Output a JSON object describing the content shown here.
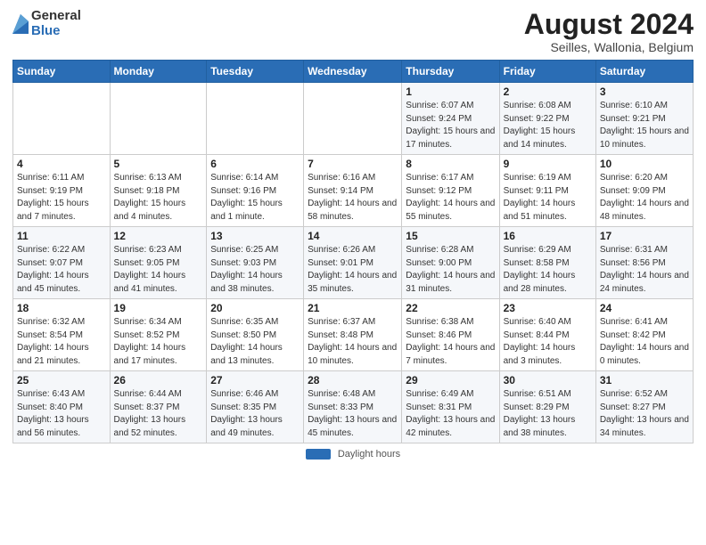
{
  "logo": {
    "general": "General",
    "blue": "Blue"
  },
  "title": "August 2024",
  "subtitle": "Seilles, Wallonia, Belgium",
  "days_of_week": [
    "Sunday",
    "Monday",
    "Tuesday",
    "Wednesday",
    "Thursday",
    "Friday",
    "Saturday"
  ],
  "weeks": [
    [
      {
        "day": "",
        "info": ""
      },
      {
        "day": "",
        "info": ""
      },
      {
        "day": "",
        "info": ""
      },
      {
        "day": "",
        "info": ""
      },
      {
        "day": "1",
        "info": "Sunrise: 6:07 AM\nSunset: 9:24 PM\nDaylight: 15 hours and 17 minutes."
      },
      {
        "day": "2",
        "info": "Sunrise: 6:08 AM\nSunset: 9:22 PM\nDaylight: 15 hours and 14 minutes."
      },
      {
        "day": "3",
        "info": "Sunrise: 6:10 AM\nSunset: 9:21 PM\nDaylight: 15 hours and 10 minutes."
      }
    ],
    [
      {
        "day": "4",
        "info": "Sunrise: 6:11 AM\nSunset: 9:19 PM\nDaylight: 15 hours and 7 minutes."
      },
      {
        "day": "5",
        "info": "Sunrise: 6:13 AM\nSunset: 9:18 PM\nDaylight: 15 hours and 4 minutes."
      },
      {
        "day": "6",
        "info": "Sunrise: 6:14 AM\nSunset: 9:16 PM\nDaylight: 15 hours and 1 minute."
      },
      {
        "day": "7",
        "info": "Sunrise: 6:16 AM\nSunset: 9:14 PM\nDaylight: 14 hours and 58 minutes."
      },
      {
        "day": "8",
        "info": "Sunrise: 6:17 AM\nSunset: 9:12 PM\nDaylight: 14 hours and 55 minutes."
      },
      {
        "day": "9",
        "info": "Sunrise: 6:19 AM\nSunset: 9:11 PM\nDaylight: 14 hours and 51 minutes."
      },
      {
        "day": "10",
        "info": "Sunrise: 6:20 AM\nSunset: 9:09 PM\nDaylight: 14 hours and 48 minutes."
      }
    ],
    [
      {
        "day": "11",
        "info": "Sunrise: 6:22 AM\nSunset: 9:07 PM\nDaylight: 14 hours and 45 minutes."
      },
      {
        "day": "12",
        "info": "Sunrise: 6:23 AM\nSunset: 9:05 PM\nDaylight: 14 hours and 41 minutes."
      },
      {
        "day": "13",
        "info": "Sunrise: 6:25 AM\nSunset: 9:03 PM\nDaylight: 14 hours and 38 minutes."
      },
      {
        "day": "14",
        "info": "Sunrise: 6:26 AM\nSunset: 9:01 PM\nDaylight: 14 hours and 35 minutes."
      },
      {
        "day": "15",
        "info": "Sunrise: 6:28 AM\nSunset: 9:00 PM\nDaylight: 14 hours and 31 minutes."
      },
      {
        "day": "16",
        "info": "Sunrise: 6:29 AM\nSunset: 8:58 PM\nDaylight: 14 hours and 28 minutes."
      },
      {
        "day": "17",
        "info": "Sunrise: 6:31 AM\nSunset: 8:56 PM\nDaylight: 14 hours and 24 minutes."
      }
    ],
    [
      {
        "day": "18",
        "info": "Sunrise: 6:32 AM\nSunset: 8:54 PM\nDaylight: 14 hours and 21 minutes."
      },
      {
        "day": "19",
        "info": "Sunrise: 6:34 AM\nSunset: 8:52 PM\nDaylight: 14 hours and 17 minutes."
      },
      {
        "day": "20",
        "info": "Sunrise: 6:35 AM\nSunset: 8:50 PM\nDaylight: 14 hours and 13 minutes."
      },
      {
        "day": "21",
        "info": "Sunrise: 6:37 AM\nSunset: 8:48 PM\nDaylight: 14 hours and 10 minutes."
      },
      {
        "day": "22",
        "info": "Sunrise: 6:38 AM\nSunset: 8:46 PM\nDaylight: 14 hours and 7 minutes."
      },
      {
        "day": "23",
        "info": "Sunrise: 6:40 AM\nSunset: 8:44 PM\nDaylight: 14 hours and 3 minutes."
      },
      {
        "day": "24",
        "info": "Sunrise: 6:41 AM\nSunset: 8:42 PM\nDaylight: 14 hours and 0 minutes."
      }
    ],
    [
      {
        "day": "25",
        "info": "Sunrise: 6:43 AM\nSunset: 8:40 PM\nDaylight: 13 hours and 56 minutes."
      },
      {
        "day": "26",
        "info": "Sunrise: 6:44 AM\nSunset: 8:37 PM\nDaylight: 13 hours and 52 minutes."
      },
      {
        "day": "27",
        "info": "Sunrise: 6:46 AM\nSunset: 8:35 PM\nDaylight: 13 hours and 49 minutes."
      },
      {
        "day": "28",
        "info": "Sunrise: 6:48 AM\nSunset: 8:33 PM\nDaylight: 13 hours and 45 minutes."
      },
      {
        "day": "29",
        "info": "Sunrise: 6:49 AM\nSunset: 8:31 PM\nDaylight: 13 hours and 42 minutes."
      },
      {
        "day": "30",
        "info": "Sunrise: 6:51 AM\nSunset: 8:29 PM\nDaylight: 13 hours and 38 minutes."
      },
      {
        "day": "31",
        "info": "Sunrise: 6:52 AM\nSunset: 8:27 PM\nDaylight: 13 hours and 34 minutes."
      }
    ]
  ],
  "footer": {
    "swatch_label": "Daylight hours"
  }
}
